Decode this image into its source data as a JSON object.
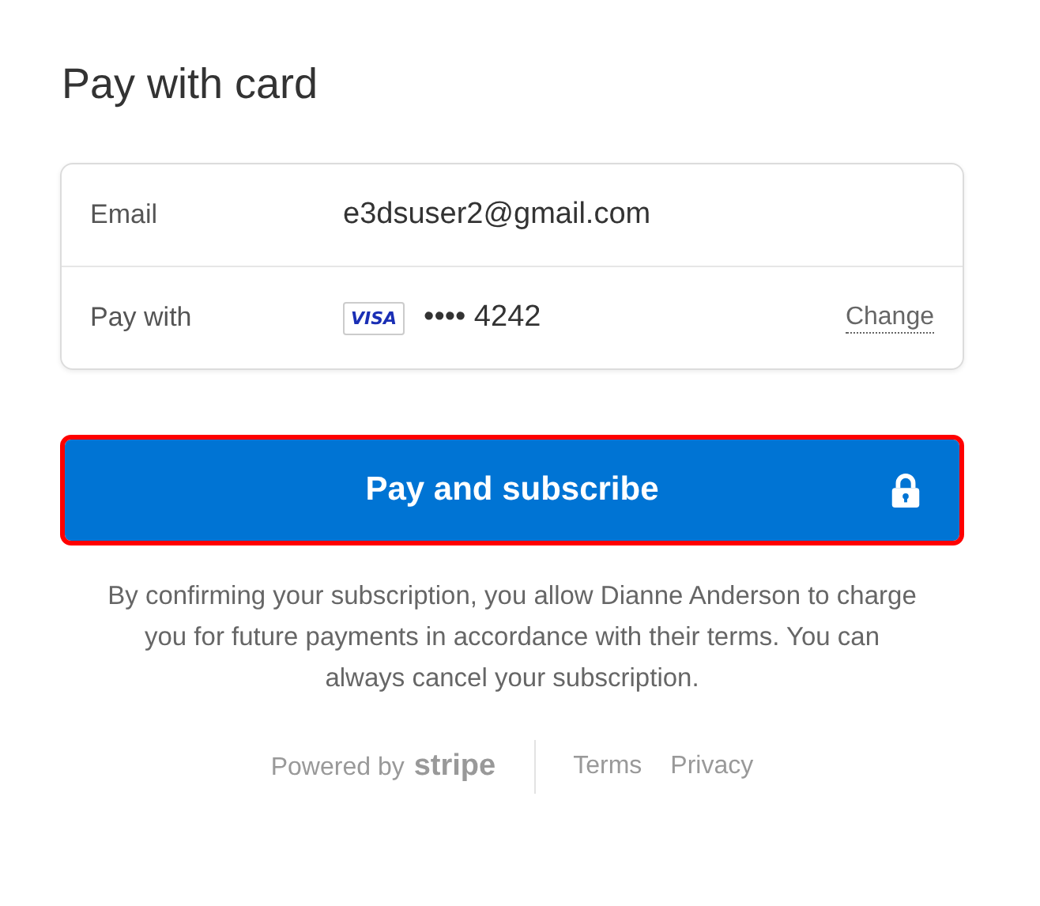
{
  "title": "Pay with card",
  "details": [
    {
      "kind": "text",
      "label": "Email",
      "value": "e3dsuser2@gmail.com"
    },
    {
      "kind": "card",
      "label": "Pay with",
      "brand": "VISA",
      "value": "•••• 4242",
      "action": "Change"
    }
  ],
  "pay_button": {
    "label": "Pay and subscribe",
    "highlighted": true
  },
  "notice": "By confirming your subscription, you allow Dianne Anderson to charge you for future payments in accordance with their terms. You can always cancel your subscription.",
  "footer": {
    "powered_by": "Powered by",
    "brand": "stripe",
    "links": [
      "Terms",
      "Privacy"
    ]
  }
}
